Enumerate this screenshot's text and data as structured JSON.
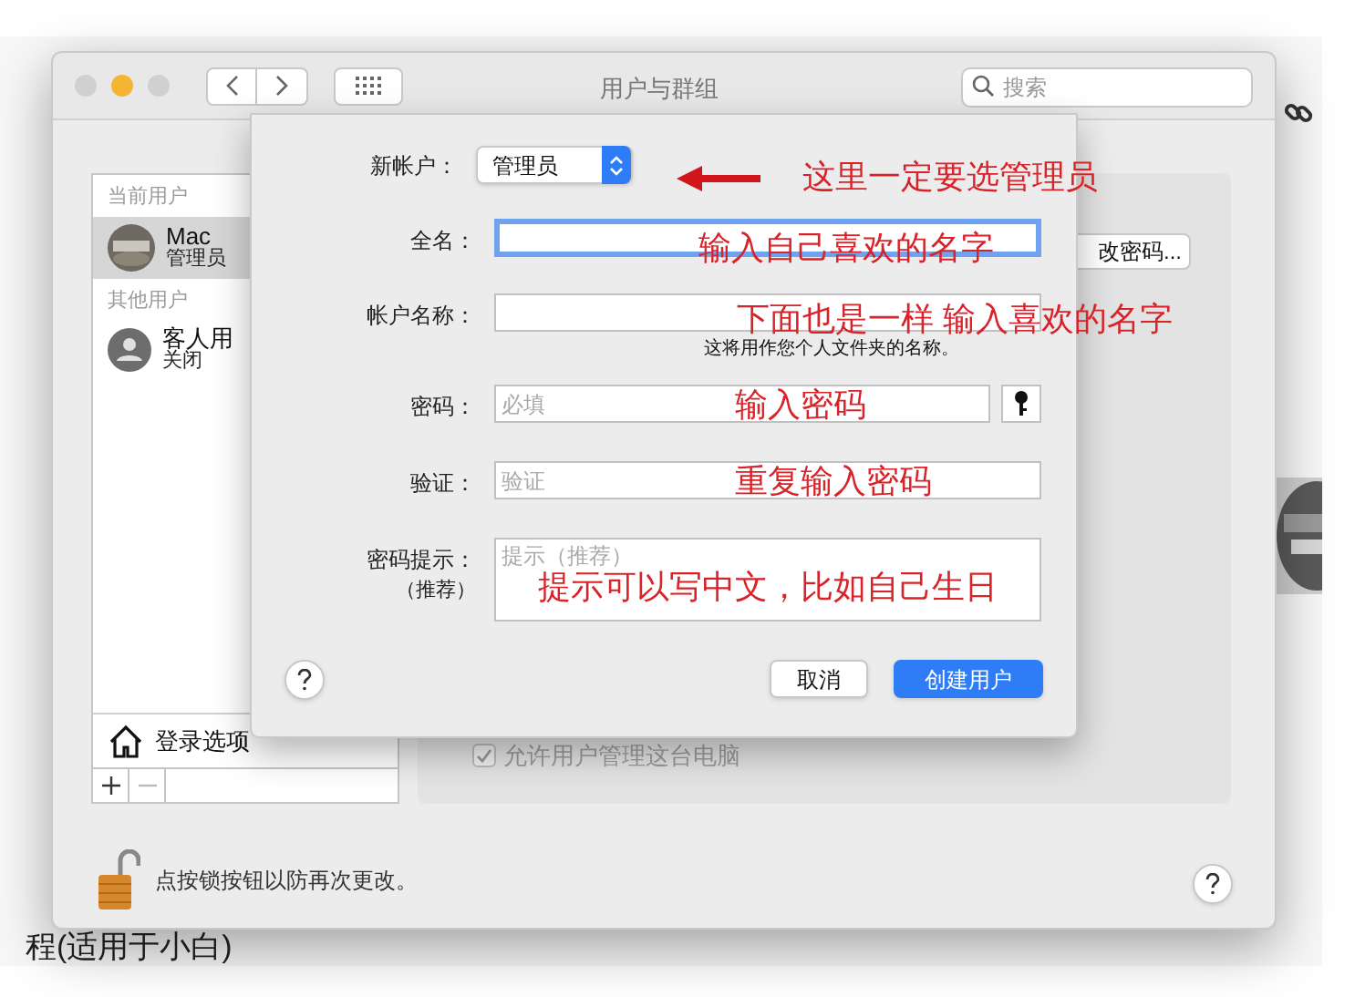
{
  "background_page": {
    "caption": "程(适用于小白)"
  },
  "window": {
    "title": "用户与群组",
    "search": {
      "placeholder": "搜索"
    }
  },
  "sidebar": {
    "sections": [
      {
        "header": "当前用户",
        "users": [
          {
            "name": "Mac",
            "role": "管理员",
            "selected": true
          }
        ]
      },
      {
        "header": "其他用户",
        "users": [
          {
            "name": "客人用",
            "role": "关闭",
            "kind": "generic",
            "selected": false
          }
        ]
      }
    ],
    "login_options": "登录选项"
  },
  "panel": {
    "change_password_button": "改密码...",
    "allow_admin": {
      "label": "允许用户管理这台电脑",
      "checked": true,
      "disabled": true
    }
  },
  "lock_text": "点按锁按钮以防再次更改。",
  "sheet": {
    "account_type": {
      "label": "新帐户：",
      "value": "管理员"
    },
    "fields": [
      {
        "label": "全名：",
        "focused": true
      },
      {
        "label": "帐户名称：",
        "focused": false,
        "note": "这将用作您个人文件夹的名称。"
      },
      {
        "label": "密码：",
        "placeholder": "必填",
        "focused": false,
        "key_button": true
      },
      {
        "label": "验证：",
        "placeholder": "验证",
        "focused": false
      },
      {
        "label": "密码提示：",
        "sublabel": "（推荐）",
        "placeholder": "提示（推荐）",
        "focused": false,
        "kind": "multiline"
      }
    ],
    "cancel_button": "取消",
    "create_button": "创建用户"
  },
  "annotations": [
    "这里一定要选管理员",
    "输入自己喜欢的名字",
    "下面也是一样 输入喜欢的名字",
    "输入密码",
    "重复输入密码",
    "提示可以写中文，比如自己生日"
  ]
}
